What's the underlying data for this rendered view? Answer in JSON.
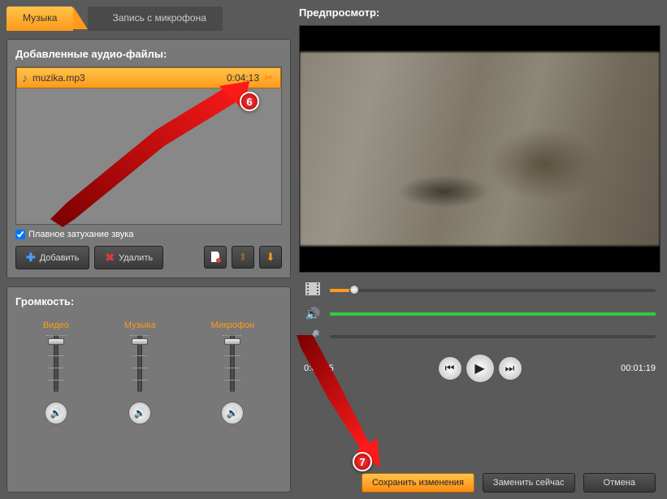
{
  "tabs": {
    "music": "Музыка",
    "mic": "Запись с микрофона"
  },
  "files": {
    "title": "Добавленные аудио-файлы:",
    "item": {
      "name": "muzika.mp3",
      "duration": "0:04:13"
    },
    "fade": "Плавное затухание звука",
    "add": "Добавить",
    "remove": "Удалить"
  },
  "volume": {
    "title": "Громкость:",
    "video": "Видео",
    "music": "Музыка",
    "mic": "Микрофон"
  },
  "preview": {
    "title": "Предпросмотр:"
  },
  "time": {
    "current": "0:00:05",
    "total": "00:01:19"
  },
  "buttons": {
    "save": "Сохранить изменения",
    "replace": "Заменить сейчас",
    "cancel": "Отмена"
  },
  "annotations": {
    "step6": "6",
    "step7": "7"
  }
}
